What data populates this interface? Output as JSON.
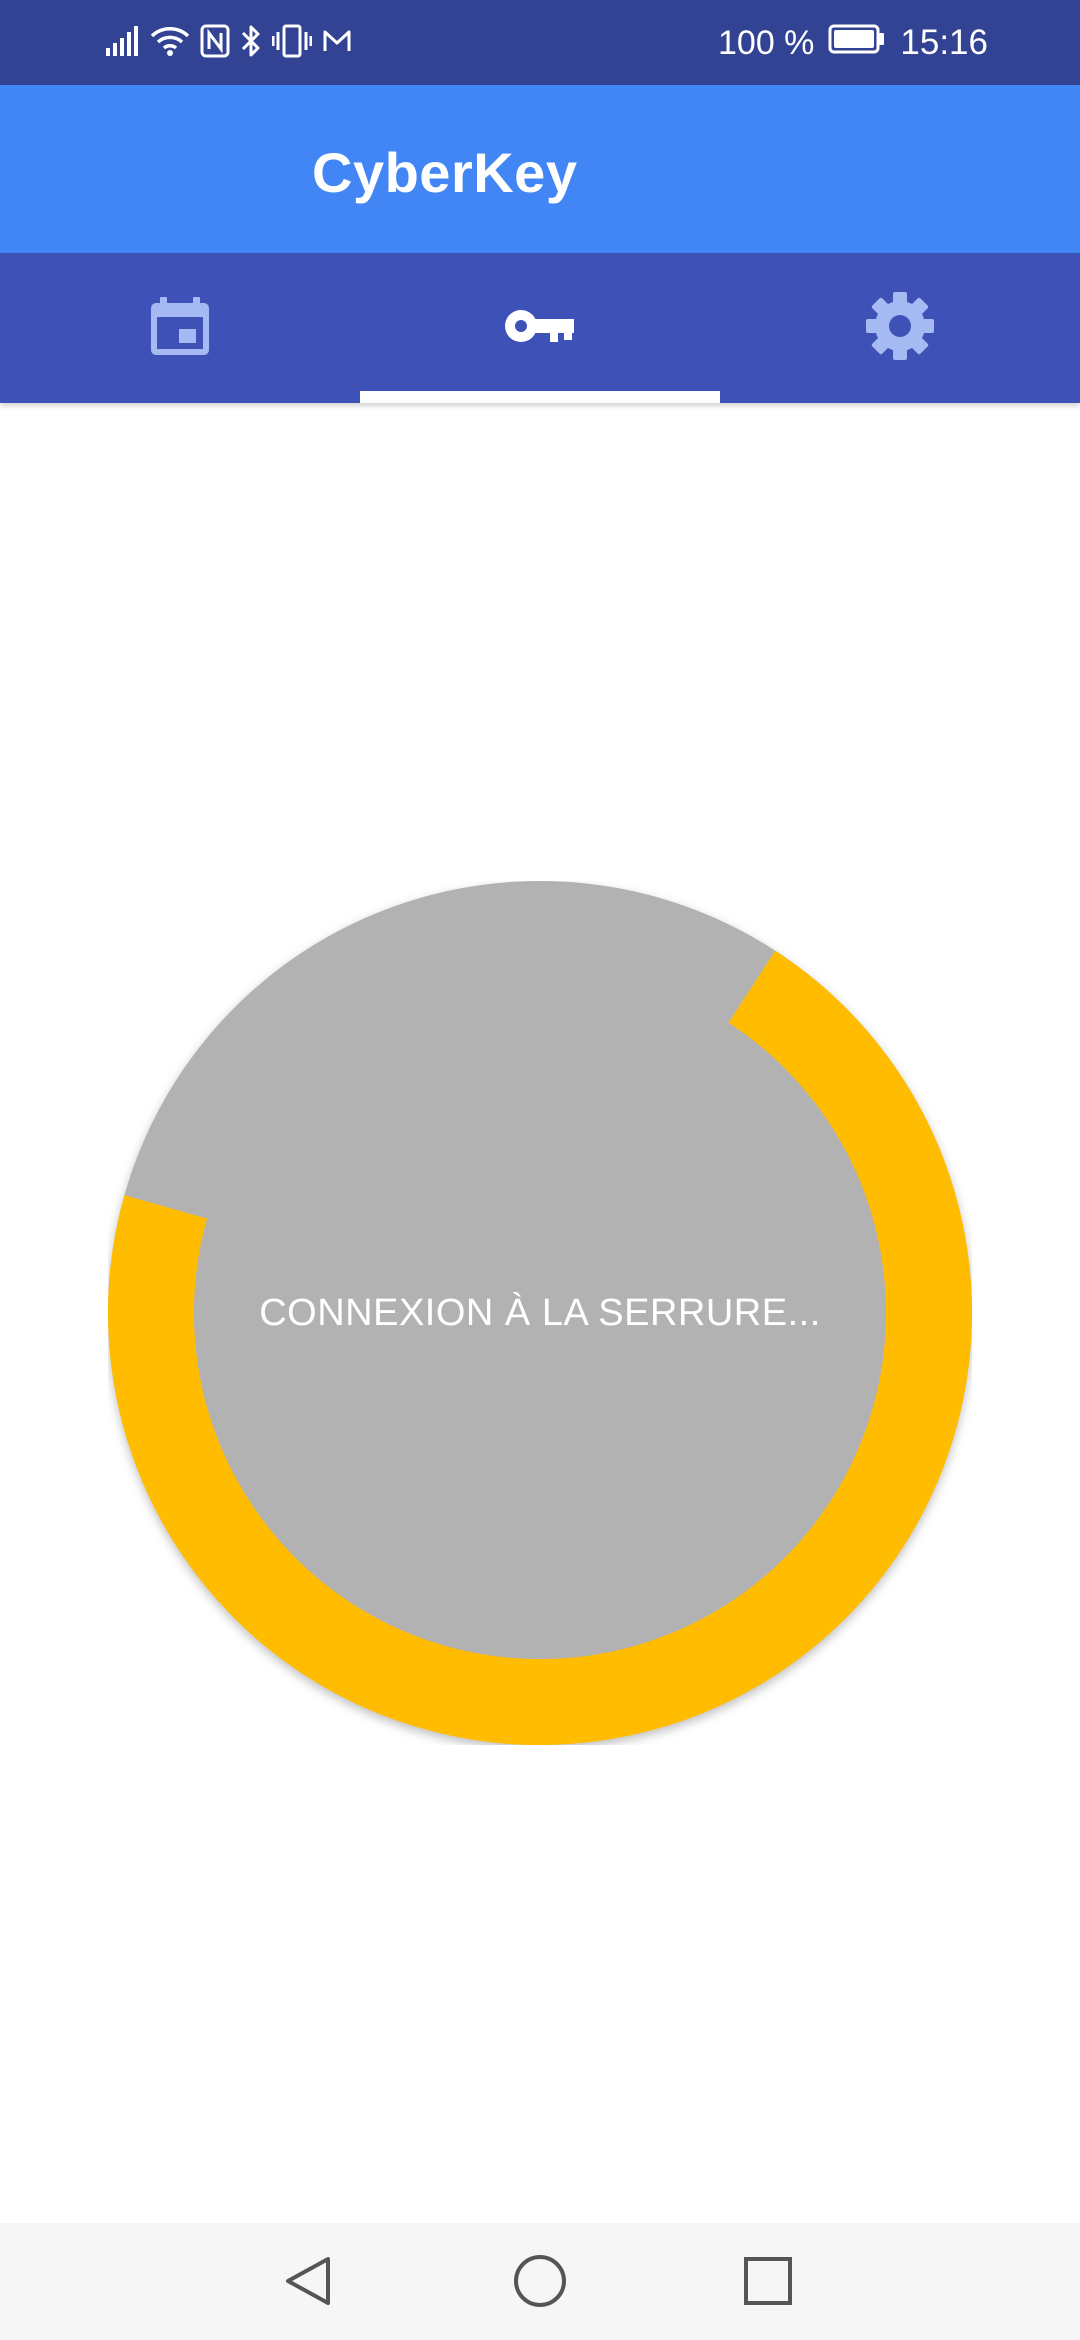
{
  "status_bar": {
    "icons": [
      "signal-icon",
      "wifi-icon",
      "nfc-icon",
      "bluetooth-icon",
      "vibrate-icon",
      "gmail-icon"
    ],
    "battery_percent": "100 %",
    "battery_icon": "battery-full-icon",
    "time": "15:16"
  },
  "app_bar": {
    "title": "CyberKey"
  },
  "tabs": [
    {
      "icon": "calendar-icon",
      "selected": false
    },
    {
      "icon": "key-icon",
      "selected": true
    },
    {
      "icon": "gear-icon",
      "selected": false
    }
  ],
  "unlock": {
    "status_text": "CONNEXION À LA SERRURE...",
    "progress_color": "#ffbc00",
    "circle_color": "#b2b2b2"
  },
  "nav_bar": {
    "icons": [
      "back-icon",
      "home-icon",
      "recents-icon"
    ]
  },
  "colors": {
    "status_bar": "#334394",
    "app_bar": "#4285f4",
    "tab_bar": "#3d51b7",
    "tab_icon_inactive": "#a5b9f2",
    "tab_icon_active": "#ffffff"
  }
}
